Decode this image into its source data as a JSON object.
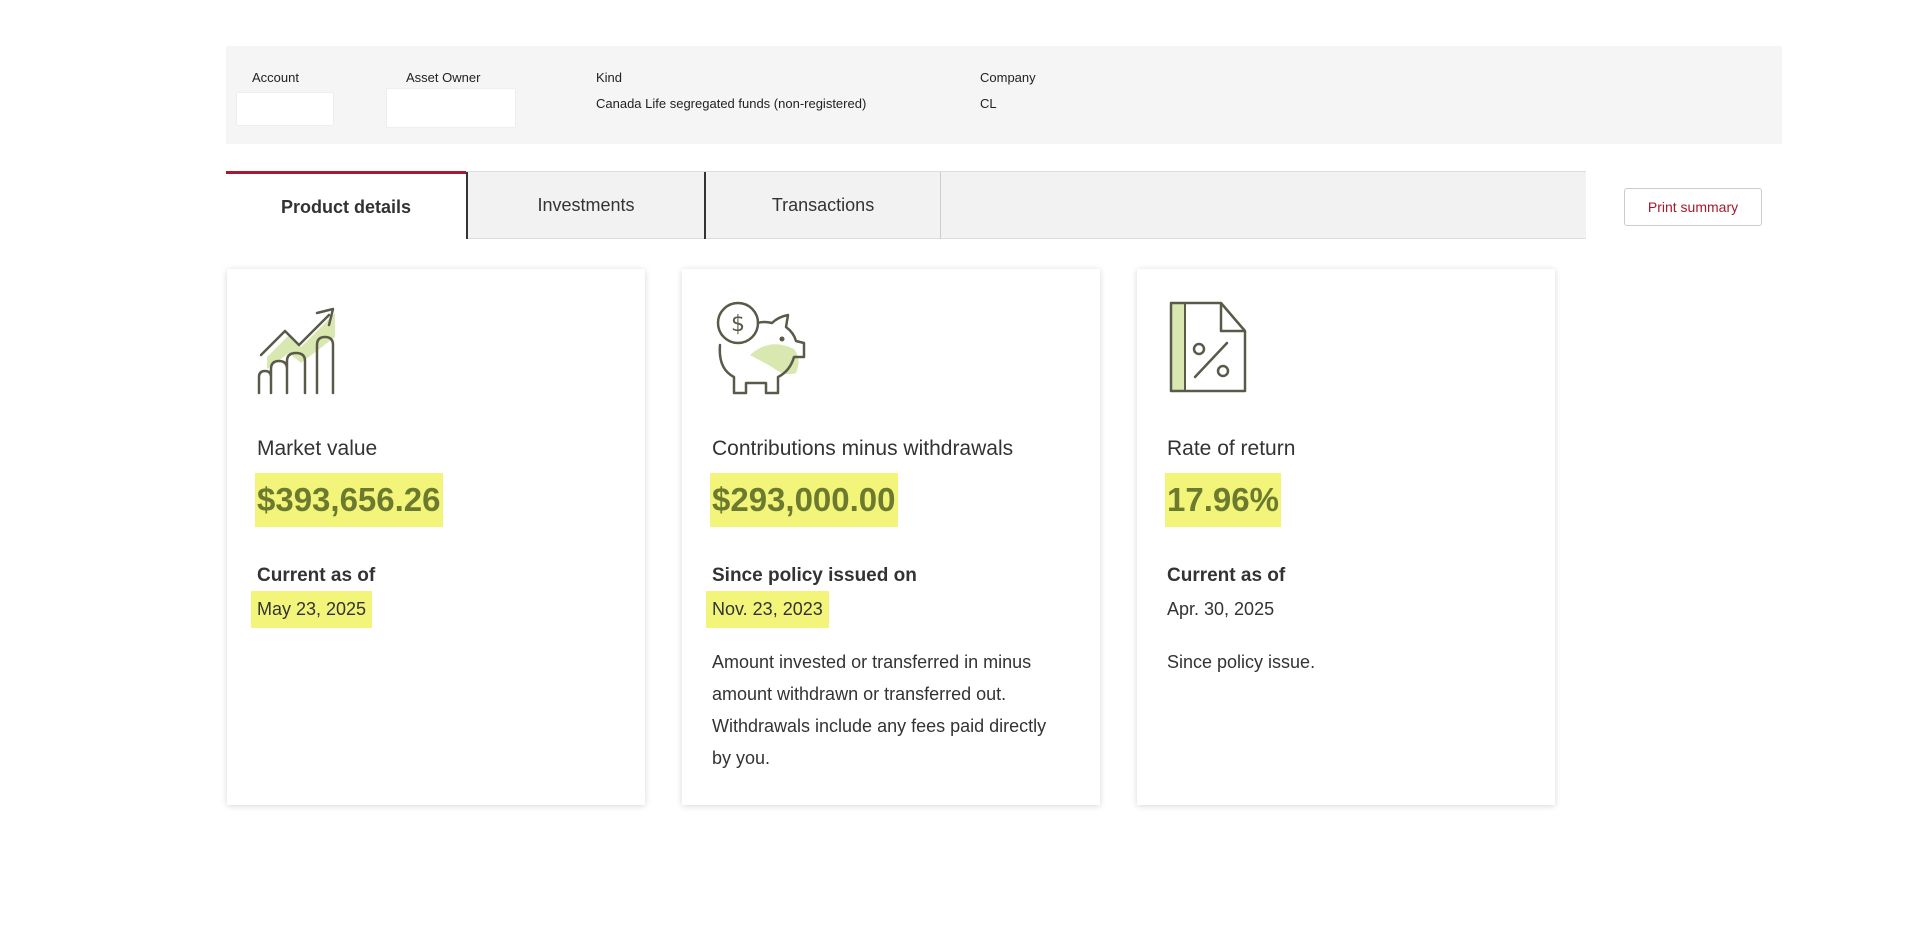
{
  "account_info": {
    "account_label": "Account",
    "account_value": "",
    "asset_owner_label": "Asset Owner",
    "asset_owner_value": "",
    "kind_label": "Kind",
    "kind_value": "Canada Life segregated funds (non-registered)",
    "company_label": "Company",
    "company_value": "CL"
  },
  "tabs": [
    {
      "label": "Product details",
      "active": true
    },
    {
      "label": "Investments",
      "active": false
    },
    {
      "label": "Transactions",
      "active": false
    }
  ],
  "print_button_label": "Print summary",
  "cards": [
    {
      "icon": "growth-chart-icon",
      "title": "Market value",
      "value": "$393,656.26",
      "sub_label": "Current as of",
      "date": "May 23, 2025",
      "note": ""
    },
    {
      "icon": "piggy-bank-icon",
      "title": "Contributions minus withdrawals",
      "value": "$293,000.00",
      "sub_label": "Since policy issued on",
      "date": "Nov. 23, 2023",
      "note": "Amount invested or transferred in minus amount withdrawn or transferred out. Withdrawals include any fees paid directly by you."
    },
    {
      "icon": "percent-document-icon",
      "title": "Rate of return",
      "value": "17.96%",
      "sub_label": "Current as of",
      "date": "Apr. 30, 2025",
      "note": "Since policy issue."
    }
  ],
  "colors": {
    "brand_red": "#a6192e",
    "highlight": "#f3f57a",
    "value_text": "#6b7a2f",
    "icon_accent": "#d9e8b0",
    "icon_stroke": "#5a5a4a"
  }
}
